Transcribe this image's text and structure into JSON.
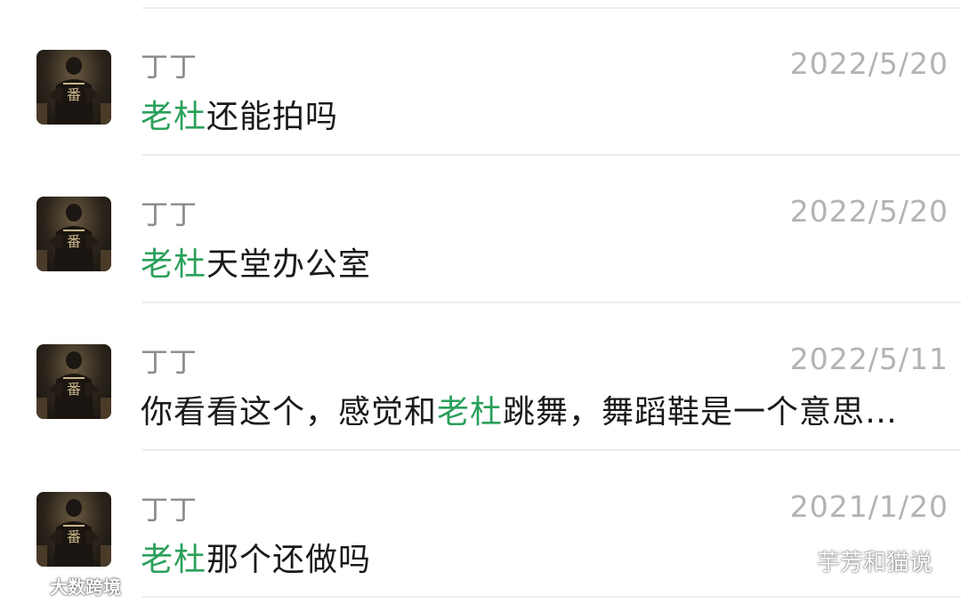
{
  "search_results": [
    {
      "sender": "丁丁",
      "date": "2022/5/20",
      "keyword": "老杜",
      "prefix": "",
      "suffix": "还能拍吗",
      "avatar_icon": "contact-avatar"
    },
    {
      "sender": "丁丁",
      "date": "2022/5/20",
      "keyword": "老杜",
      "prefix": "",
      "suffix": "天堂办公室",
      "avatar_icon": "contact-avatar"
    },
    {
      "sender": "丁丁",
      "date": "2022/5/11",
      "keyword": "老杜",
      "prefix": "你看看这个，感觉和",
      "suffix": "跳舞，舞蹈鞋是一个意思…",
      "avatar_icon": "contact-avatar"
    },
    {
      "sender": "丁丁",
      "date": "2021/1/20",
      "keyword": "老杜",
      "prefix": "",
      "suffix": "那个还做吗",
      "avatar_icon": "contact-avatar"
    }
  ],
  "watermarks": {
    "right_text": "芋芳和猫说",
    "right_icon": "wechat-official-account-icon",
    "left_text": "大数跨境",
    "left_icon": "weibo-icon"
  },
  "colors": {
    "highlight": "#2aa05a",
    "sender": "#8a8a8a",
    "date": "#b3b3b3",
    "message": "#1a1a1a",
    "divider": "#ededed"
  }
}
